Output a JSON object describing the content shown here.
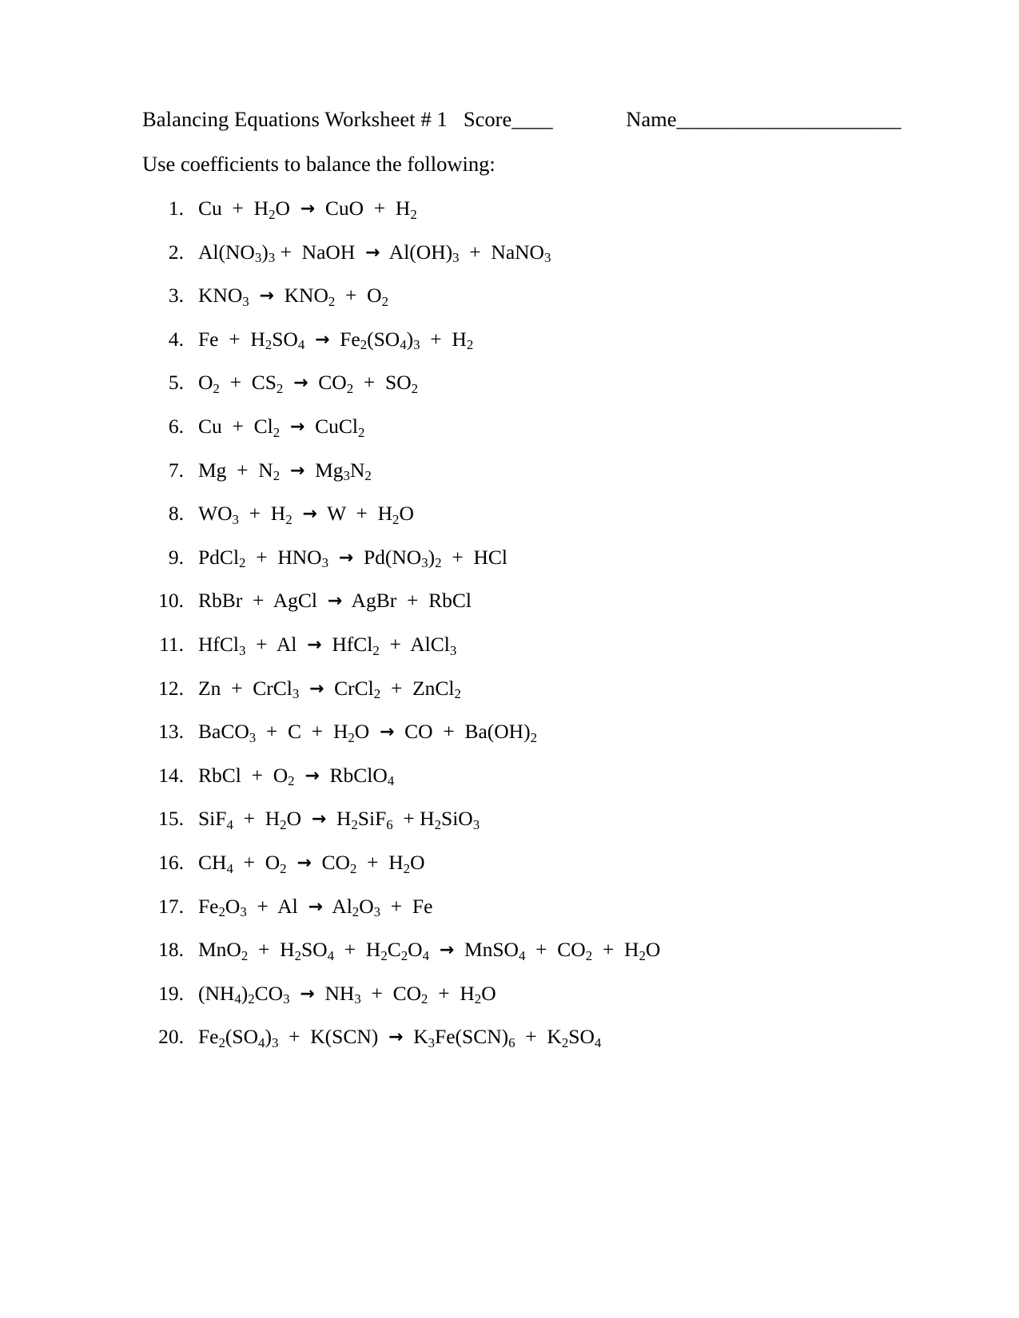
{
  "document": {
    "header": {
      "title": "Balancing Equations Worksheet # 1",
      "score_label": "Score",
      "score_blank": "____",
      "name_label": "Name",
      "name_blank": "______________________"
    },
    "instruction": "Use coefficients to balance the following:",
    "arrow_glyph": "→",
    "equations": [
      {
        "number": "1.",
        "reactants": [
          {
            "formula": "Cu"
          },
          {
            "formula": "H2O"
          }
        ],
        "products": [
          {
            "formula": "CuO"
          },
          {
            "formula": "H2"
          }
        ],
        "text": "Cu  +  H2O  →  CuO  +  H2"
      },
      {
        "number": "2.",
        "reactants": [
          {
            "formula": "Al(NO3)3"
          },
          {
            "formula": "NaOH"
          }
        ],
        "products": [
          {
            "formula": "Al(OH)3"
          },
          {
            "formula": "NaNO3"
          }
        ],
        "text": "Al(NO3)3 +  NaOH  →  Al(OH)3  +  NaNO3"
      },
      {
        "number": "3.",
        "reactants": [
          {
            "formula": "KNO3"
          }
        ],
        "products": [
          {
            "formula": "KNO2"
          },
          {
            "formula": "O2"
          }
        ],
        "text": "KNO3  →  KNO2  +  O2"
      },
      {
        "number": "4.",
        "reactants": [
          {
            "formula": "Fe"
          },
          {
            "formula": "H2SO4"
          }
        ],
        "products": [
          {
            "formula": "Fe2(SO4)3"
          },
          {
            "formula": "H2"
          }
        ],
        "text": "Fe  +  H2SO4  →  Fe2(SO4)3  +  H2"
      },
      {
        "number": "5.",
        "reactants": [
          {
            "formula": "O2"
          },
          {
            "formula": "CS2"
          }
        ],
        "products": [
          {
            "formula": "CO2"
          },
          {
            "formula": "SO2"
          }
        ],
        "text": "O2  +  CS2  →  CO2  +  SO2"
      },
      {
        "number": "6.",
        "reactants": [
          {
            "formula": "Cu"
          },
          {
            "formula": "Cl2"
          }
        ],
        "products": [
          {
            "formula": "CuCl2"
          }
        ],
        "text": "Cu  +  Cl2  →  CuCl2"
      },
      {
        "number": "7.",
        "reactants": [
          {
            "formula": "Mg"
          },
          {
            "formula": "N2"
          }
        ],
        "products": [
          {
            "formula": "Mg3N2"
          }
        ],
        "text": "Mg  +  N2  →  Mg3N2"
      },
      {
        "number": "8.",
        "reactants": [
          {
            "formula": "WO3"
          },
          {
            "formula": "H2"
          }
        ],
        "products": [
          {
            "formula": "W"
          },
          {
            "formula": "H2O"
          }
        ],
        "text": "WO3  +  H2  →  W  +  H2O"
      },
      {
        "number": "9.",
        "reactants": [
          {
            "formula": "PdCl2"
          },
          {
            "formula": "HNO3"
          }
        ],
        "products": [
          {
            "formula": "Pd(NO3)2"
          },
          {
            "formula": "HCl"
          }
        ],
        "text": "PdCl2  +  HNO3  →  Pd(NO3)2  +  HCl"
      },
      {
        "number": "10.",
        "reactants": [
          {
            "formula": "RbBr"
          },
          {
            "formula": "AgCl"
          }
        ],
        "products": [
          {
            "formula": "AgBr"
          },
          {
            "formula": "RbCl"
          }
        ],
        "text": "RbBr  +  AgCl  →  AgBr  +  RbCl"
      },
      {
        "number": "11.",
        "reactants": [
          {
            "formula": "HfCl3"
          },
          {
            "formula": "Al"
          }
        ],
        "products": [
          {
            "formula": "HfCl2"
          },
          {
            "formula": "AlCl3"
          }
        ],
        "text": "HfCl3  +  Al  →  HfCl2  +  AlCl3"
      },
      {
        "number": "12.",
        "reactants": [
          {
            "formula": "Zn"
          },
          {
            "formula": "CrCl3"
          }
        ],
        "products": [
          {
            "formula": "CrCl2"
          },
          {
            "formula": "ZnCl2"
          }
        ],
        "text": "Zn  +  CrCl3  →  CrCl2  +  ZnCl2"
      },
      {
        "number": "13.",
        "reactants": [
          {
            "formula": "BaCO3"
          },
          {
            "formula": "C"
          },
          {
            "formula": "H2O"
          }
        ],
        "products": [
          {
            "formula": "CO"
          },
          {
            "formula": "Ba(OH)2"
          }
        ],
        "text": "BaCO3  +  C  +  H2O  →  CO  +  Ba(OH)2"
      },
      {
        "number": "14.",
        "reactants": [
          {
            "formula": "RbCl"
          },
          {
            "formula": "O2"
          }
        ],
        "products": [
          {
            "formula": "RbClO4"
          }
        ],
        "text": "RbCl  +  O2  →  RbClO4"
      },
      {
        "number": "15.",
        "reactants": [
          {
            "formula": "SiF4"
          },
          {
            "formula": "H2O"
          }
        ],
        "products": [
          {
            "formula": "H2SiF6"
          },
          {
            "formula": "H2SiO3"
          }
        ],
        "text": "SiF4  +  H2O  →  H2SiF6  + H2SiO3"
      },
      {
        "number": "16.",
        "reactants": [
          {
            "formula": "CH4"
          },
          {
            "formula": "O2"
          }
        ],
        "products": [
          {
            "formula": "CO2"
          },
          {
            "formula": "H2O"
          }
        ],
        "text": "CH4  +  O2  →  CO2  +  H2O"
      },
      {
        "number": "17.",
        "reactants": [
          {
            "formula": "Fe2O3"
          },
          {
            "formula": "Al"
          }
        ],
        "products": [
          {
            "formula": "Al2O3"
          },
          {
            "formula": "Fe"
          }
        ],
        "text": "Fe2O3  +  Al  →  Al2O3  +  Fe"
      },
      {
        "number": "18.",
        "reactants": [
          {
            "formula": "MnO2"
          },
          {
            "formula": "H2SO4"
          },
          {
            "formula": "H2C2O4"
          }
        ],
        "products": [
          {
            "formula": "MnSO4"
          },
          {
            "formula": "CO2"
          },
          {
            "formula": "H2O"
          }
        ],
        "text": "MnO2  +  H2SO4  +  H2C2O4  →  MnSO4  +  CO2  +  H2O"
      },
      {
        "number": "19.",
        "reactants": [
          {
            "formula": "(NH4)2CO3"
          }
        ],
        "products": [
          {
            "formula": "NH3"
          },
          {
            "formula": "CO2"
          },
          {
            "formula": "H2O"
          }
        ],
        "text": "(NH4)2CO3  →  NH3  +  CO2  +  H2O"
      },
      {
        "number": "20.",
        "reactants": [
          {
            "formula": "Fe2(SO4)3"
          },
          {
            "formula": "K(SCN)"
          }
        ],
        "products": [
          {
            "formula": "K3Fe(SCN)6"
          },
          {
            "formula": "K2SO4"
          }
        ],
        "text": "Fe2(SO4)3  +  K(SCN)  →  K3Fe(SCN)6  +  K2SO4"
      }
    ]
  }
}
